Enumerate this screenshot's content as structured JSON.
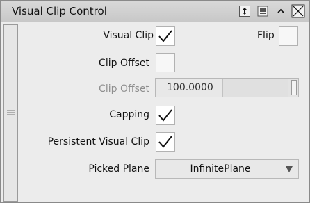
{
  "panel": {
    "title": "Visual Clip Control",
    "buttons": {
      "resize_icon": "vertical-resize-icon",
      "menu_icon": "menu-icon",
      "collapse_icon": "chevron-up-icon",
      "close_icon": "close-icon"
    }
  },
  "fields": {
    "visual_clip": {
      "label": "Visual Clip",
      "checked": true
    },
    "flip": {
      "label": "Flip",
      "checked": false
    },
    "clip_offset_toggle": {
      "label": "Clip Offset",
      "checked": false
    },
    "clip_offset_value": {
      "label": "Clip Offset",
      "value": "100.0000",
      "slider_fraction": 1.0,
      "disabled": true
    },
    "capping": {
      "label": "Capping",
      "checked": true
    },
    "persistent_visual_clip": {
      "label": "Persistent Visual Clip",
      "checked": true
    },
    "picked_plane": {
      "label": "Picked Plane",
      "value": "InfinitePlane"
    }
  },
  "colors": {
    "checkbox_checked_bg": "#ffffff",
    "disabled_label": "#8f8f8f",
    "titlebar": "#cfcfcf"
  }
}
